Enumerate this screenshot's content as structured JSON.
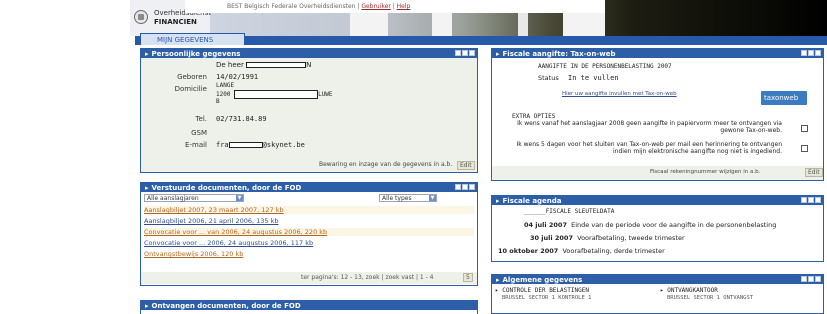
{
  "header": {
    "logo_line1": "Overheidsdienst",
    "logo_line2": "FINANCIEN",
    "status_text": "BEST Belgisch Federale Overheidsdiensten |",
    "status_link1": "Gebruiker",
    "status_link2": "Help"
  },
  "tab": {
    "label": "MIJN GEGEVENS"
  },
  "personal": {
    "title": "Persoonlijke gegevens",
    "name_value_prefix": "De heer",
    "name_value_suffix": "N",
    "birth_label": "Geboren",
    "birth_value": "14/02/1991",
    "address_label": "Domicilie",
    "address_line1": "LANGE",
    "address_line2": "1200",
    "address_line2_suffix": "LUWE",
    "address_line3": "B",
    "tel_label": "Tel.",
    "tel_value": "02/731.84.89",
    "gsm_label": "GSM",
    "email_label": "E-mail",
    "email_prefix": "fra",
    "email_suffix": "@skynet.be",
    "footer_text": "Bewaring en inzage van de gegevens in a.b.",
    "edit_button": "Edit"
  },
  "sent_docs": {
    "title": "Verstuurde documenten, door de FOD",
    "filter_select": "Alle aanslagjaren",
    "type_select": "Alle types",
    "items": [
      "Aanslagbiljet 2007, 23 maart 2007, 127 kb",
      "Aanslagbiljet 2006, 21 april 2006, 135 kb",
      "Convocatie voor ... van 2006, 24 augustus 2006, 220 kb",
      "Convocatie voor ... 2006, 24 augustus 2006, 117 kb",
      "Ontvangstbewijs 2006, 120 kb"
    ],
    "footer_text": "ter pagina's: 12 - 13, zoek | zoek vast | 1 - 4",
    "footer_count": "5"
  },
  "received_docs": {
    "title": "Ontvangen documenten, door de FOD"
  },
  "tax_return": {
    "title": "Fiscale aangifte: Tax-on-web",
    "heading": "AANGIFTE IN DE PERSONENBELASTING 2007",
    "status_label": "Status",
    "status_value": "In te vullen",
    "link_text": "Hier uw aangifte invullen met Tax-on-web",
    "badge_label": "taxonweb",
    "options_heading": "EXTRA OPTIES",
    "option1": "Ik wens vanaf het aanslagjaar 2008 geen aangifte in papiervorm meer te ontvangen via gewone Tax-on-web.",
    "option2": "Ik wens 5 dagen voor het sluiten van Tax-on-web per mail een herinnering te ontvangen indien mijn elektronische aangifte nog niet is ingediend.",
    "footer_text": "Fiscaal rekeningnummer wijzigen in a.b.",
    "edit_button": "Edit"
  },
  "agenda": {
    "title": "Fiscale agenda",
    "heading": "FISCALE SLEUTELDATA",
    "entries": [
      {
        "date": "04 juli 2007",
        "text": "Einde van de periode voor de aangifte in de personenbelasting"
      },
      {
        "date": "30 juli 2007",
        "text": "Voorafbetaling, tweede trimester"
      },
      {
        "date": "10 oktober 2007",
        "text": "Voorafbetaling, derde trimester"
      }
    ]
  },
  "general": {
    "title": "Algemene gegevens",
    "col1_heading": "CONTROLE DER BELASTINGEN",
    "col1_line": "BRUSSEL SECTOR 1 KONTROLE 1",
    "col2_heading": "ONTVANGKANTOOR",
    "col2_line": "BRUSSEL SECTOR 1 ONTVANGST"
  },
  "colors": {
    "panel_blue": "#2d5fa8",
    "panel_bg": "#eef1e9",
    "link_orange": "#b5651d",
    "link_blue": "#2d4f8f"
  }
}
